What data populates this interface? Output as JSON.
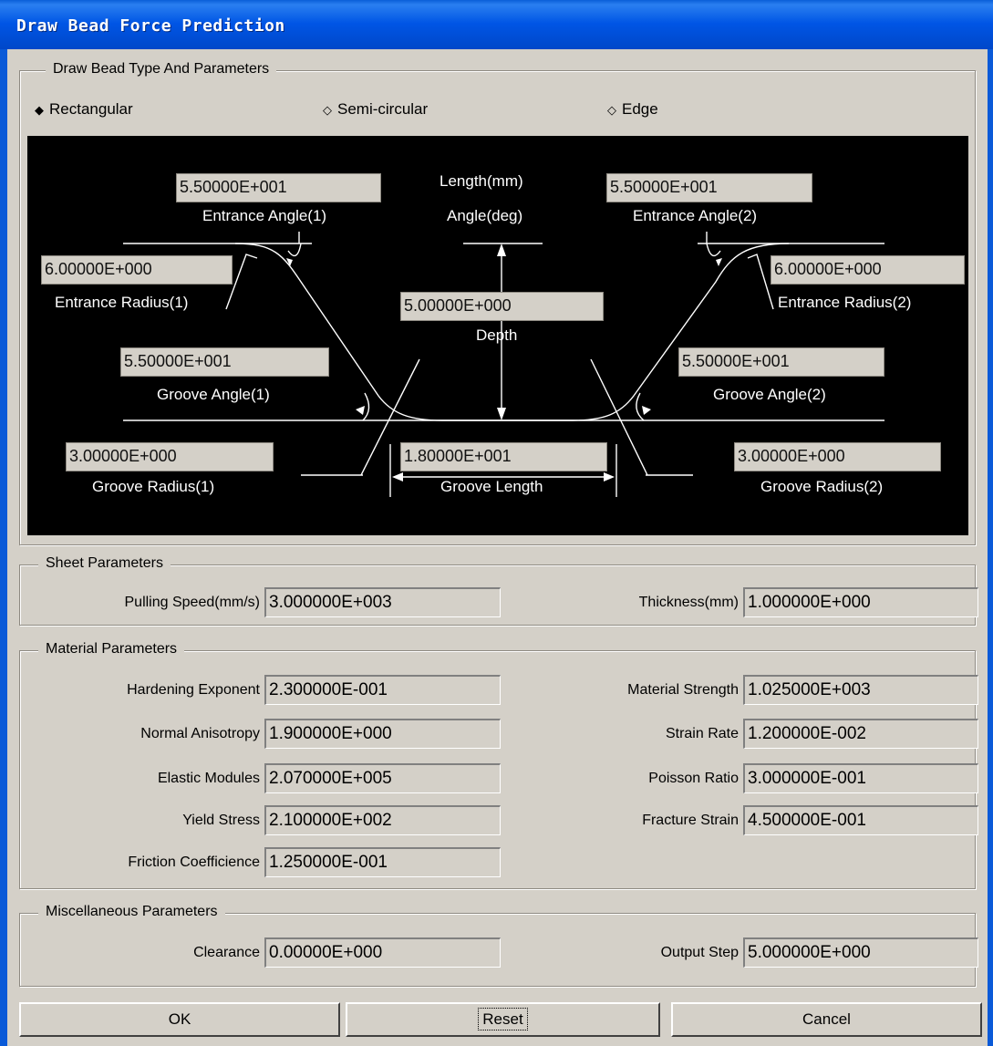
{
  "window": {
    "title": "Draw Bead Force Prediction"
  },
  "bead_type": {
    "legend": "Draw Bead Type And Parameters",
    "options": [
      "Rectangular",
      "Semi-circular",
      "Edge"
    ],
    "selected": "Rectangular",
    "selected_mark": "◆",
    "unselected_mark": "◇"
  },
  "diagram": {
    "units_line1": "Length(mm)",
    "units_line2": "Angle(deg)",
    "entrance_angle_1": {
      "value": "5.50000E+001",
      "label": "Entrance Angle(1)"
    },
    "entrance_angle_2": {
      "value": "5.50000E+001",
      "label": "Entrance Angle(2)"
    },
    "entrance_radius_1": {
      "value": "6.00000E+000",
      "label": "Entrance Radius(1)"
    },
    "entrance_radius_2": {
      "value": "6.00000E+000",
      "label": "Entrance Radius(2)"
    },
    "depth": {
      "value": "5.00000E+000",
      "label": "Depth"
    },
    "groove_angle_1": {
      "value": "5.50000E+001",
      "label": "Groove Angle(1)"
    },
    "groove_angle_2": {
      "value": "5.50000E+001",
      "label": "Groove Angle(2)"
    },
    "groove_radius_1": {
      "value": "3.00000E+000",
      "label": "Groove Radius(1)"
    },
    "groove_radius_2": {
      "value": "3.00000E+000",
      "label": "Groove Radius(2)"
    },
    "groove_length": {
      "value": "1.80000E+001",
      "label": "Groove Length"
    }
  },
  "sheet": {
    "legend": "Sheet Parameters",
    "pulling_speed": {
      "label": "Pulling Speed(mm/s)",
      "value": "3.000000E+003"
    },
    "thickness": {
      "label": "Thickness(mm)",
      "value": "1.000000E+000"
    }
  },
  "material": {
    "legend": "Material Parameters",
    "hardening_exponent": {
      "label": "Hardening Exponent",
      "value": "2.300000E-001"
    },
    "material_strength": {
      "label": "Material Strength",
      "value": "1.025000E+003"
    },
    "normal_anisotropy": {
      "label": "Normal Anisotropy",
      "value": "1.900000E+000"
    },
    "strain_rate": {
      "label": "Strain Rate",
      "value": "1.200000E-002"
    },
    "elastic_modules": {
      "label": "Elastic Modules",
      "value": "2.070000E+005"
    },
    "poisson_ratio": {
      "label": "Poisson Ratio",
      "value": "3.000000E-001"
    },
    "yield_stress": {
      "label": "Yield Stress",
      "value": "2.100000E+002"
    },
    "fracture_strain": {
      "label": "Fracture Strain",
      "value": "4.500000E-001"
    },
    "friction_coefficience": {
      "label": "Friction Coefficience",
      "value": "1.250000E-001"
    }
  },
  "misc": {
    "legend": "Miscellaneous Parameters",
    "clearance": {
      "label": "Clearance",
      "value": "0.00000E+000"
    },
    "output_step": {
      "label": "Output Step",
      "value": "5.000000E+000"
    }
  },
  "buttons": {
    "ok": "OK",
    "reset": "Reset",
    "cancel": "Cancel"
  },
  "colors": {
    "title_bar": "#0055e5",
    "dialog_bg": "#d4d0c8",
    "diagram_bg": "#000000",
    "diagram_lines": "#ffffff"
  }
}
